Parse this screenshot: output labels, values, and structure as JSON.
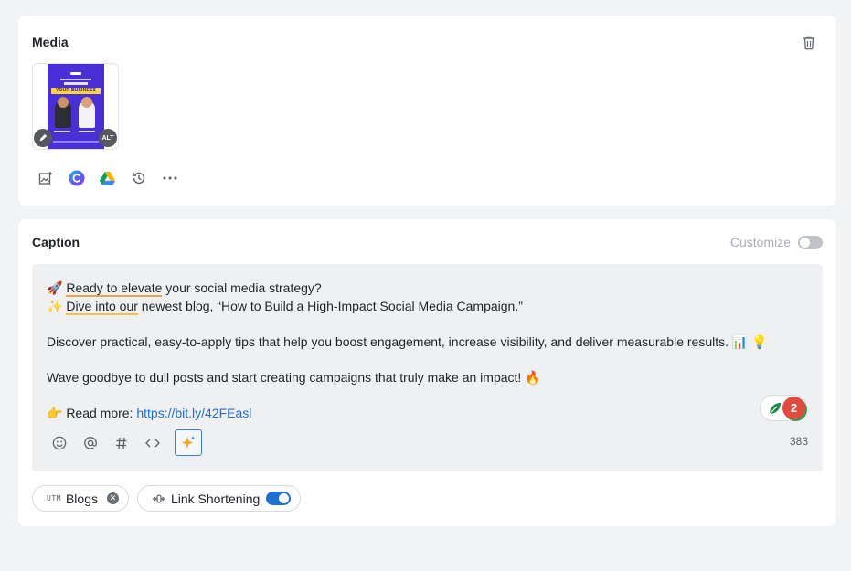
{
  "media": {
    "title": "Media",
    "thumbnail": {
      "banner_text": "YOUR BUSINESS",
      "alt_label": "ALT"
    },
    "tools": [
      "add-image-icon",
      "canva-icon",
      "google-drive-icon",
      "history-icon",
      "more-icon"
    ]
  },
  "caption": {
    "title": "Caption",
    "customize_label": "Customize",
    "customize_enabled": false,
    "lines": {
      "l1_pre": "🚀 ",
      "l1_u": "Ready to elevate",
      "l1_post": " your social media strategy?",
      "l2_pre": "✨ ",
      "l2_u": "Dive into our",
      "l2_post": " newest blog, “How to Build a High-Impact Social Media Campaign.”",
      "l3": "Discover practical, easy-to-apply tips that help you boost engagement, increase visibility, and deliver measurable results. 📊 💡",
      "l4": "Wave goodbye to dull posts and start creating campaigns that truly make an impact! 🔥",
      "l5_pre": "👉 Read more: ",
      "l5_link": "https://bit.ly/42FEasl"
    },
    "grammar_issue_count": "2",
    "char_count": "383"
  },
  "chips": {
    "utm_prefix": "UTM",
    "utm_label": "Blogs",
    "link_shortening_label": "Link Shortening",
    "link_shortening_enabled": true
  },
  "colors": {
    "accent": "#1f6fd1",
    "background": "#f2f3f5",
    "editor_bg": "#eef0f2",
    "grammar_red": "#e04a3f"
  }
}
